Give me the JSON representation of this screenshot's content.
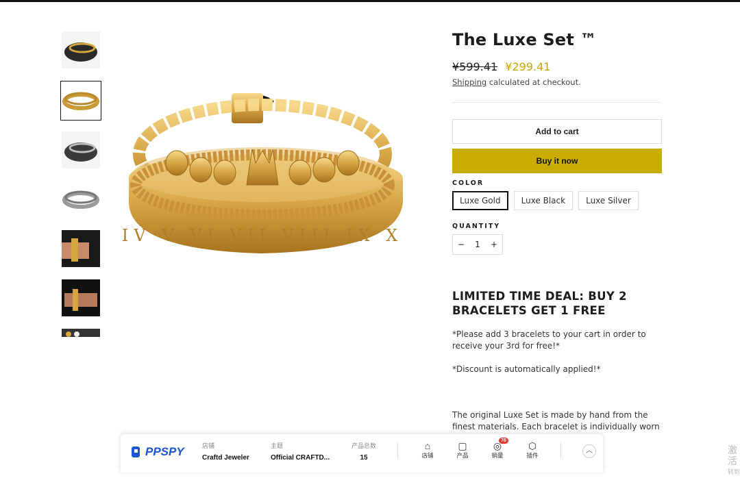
{
  "product": {
    "title": "The Luxe Set ™",
    "old_price": "¥599.41",
    "new_price": "¥299.41",
    "shipping_link": "Shipping",
    "shipping_rest": " calculated at checkout.",
    "add_to_cart": "Add to cart",
    "buy_now": "Buy it now",
    "color_label": "COLOR",
    "colors": [
      "Luxe Gold",
      "Luxe Black",
      "Luxe Silver"
    ],
    "quantity_label": "QUANTITY",
    "qty_minus": "−",
    "qty_value": "1",
    "qty_plus": "+"
  },
  "description": {
    "deal_heading": "LIMITED TIME DEAL: BUY 2 BRACELETS GET 1 FREE",
    "p1": "*Please add 3 bracelets to your cart in order to receive your 3rd for free!*",
    "p2": "*Discount is automatically applied!*",
    "p3": "The original Luxe Set is made by hand from the finest materials. Each bracelet is individually worn ce of luxury on your"
  },
  "ppspy": {
    "logo": "PPSPY",
    "store_label": "店铺",
    "store_value": "Craftd Jeweler",
    "theme_label": "主题",
    "theme_value": "Official CRAFTD...",
    "count_label": "产品总数",
    "count_value": "15",
    "nav": [
      {
        "label": "店铺",
        "icon": "home-icon"
      },
      {
        "label": "产品",
        "icon": "bag-icon"
      },
      {
        "label": "销量",
        "icon": "sales-icon",
        "badge": "76"
      },
      {
        "label": "插件",
        "icon": "cube-icon"
      }
    ]
  },
  "watermark": {
    "line1": "激活",
    "line2": "转到"
  },
  "colors": {
    "accent": "#c9ac00",
    "price": "#c8a400",
    "ppspy_blue": "#1a56d6"
  }
}
